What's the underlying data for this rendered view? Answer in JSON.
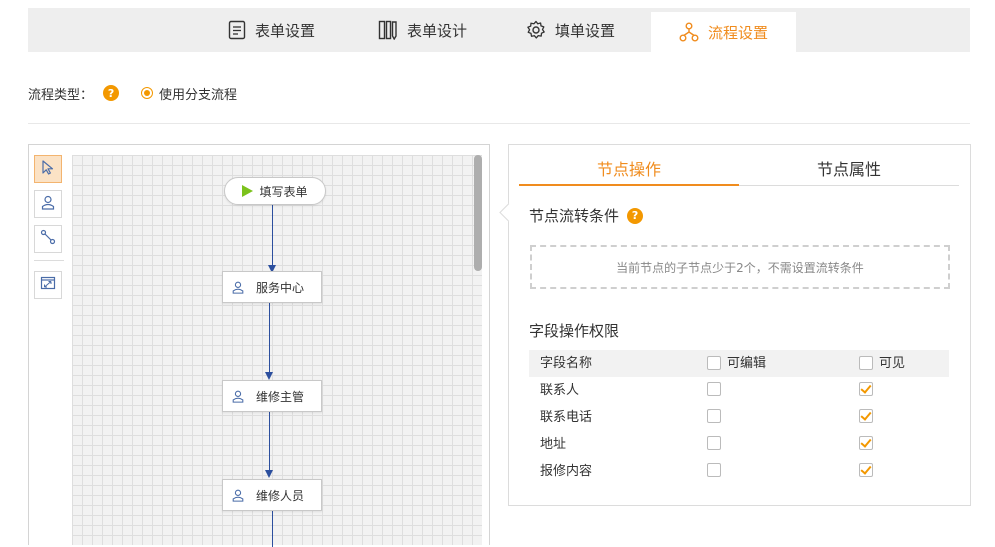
{
  "tabs": [
    {
      "label": "表单设置",
      "icon": "form-settings-icon"
    },
    {
      "label": "表单设计",
      "icon": "form-design-icon"
    },
    {
      "label": "填单设置",
      "icon": "gear-icon"
    },
    {
      "label": "流程设置",
      "icon": "flow-icon",
      "active": true
    }
  ],
  "process_type": {
    "label": "流程类型：",
    "help": "?",
    "option_label": "使用分支流程",
    "selected": true
  },
  "tools": [
    {
      "icon": "pointer-icon",
      "active": true
    },
    {
      "icon": "user-node-icon"
    },
    {
      "icon": "connector-icon"
    },
    {
      "icon": "fit-view-icon"
    }
  ],
  "flow": {
    "start": "填写表单",
    "nodes": [
      "服务中心",
      "维修主管",
      "维修人员"
    ]
  },
  "right": {
    "tabs": [
      "节点操作",
      "节点属性"
    ],
    "condition_title": "节点流转条件",
    "help": "?",
    "condition_hint": "当前节点的子节点少于2个，不需设置流转条件",
    "perm_title": "字段操作权限",
    "headers": {
      "name": "字段名称",
      "editable": "可编辑",
      "visible": "可见"
    },
    "rows": [
      {
        "name": "联系人",
        "editable": false,
        "visible": true
      },
      {
        "name": "联系电话",
        "editable": false,
        "visible": true
      },
      {
        "name": "地址",
        "editable": false,
        "visible": true
      },
      {
        "name": "报修内容",
        "editable": false,
        "visible": true
      }
    ]
  },
  "colors": {
    "accent": "#f08c1e",
    "edge": "#2c4f9e",
    "start": "#7cc21d"
  }
}
